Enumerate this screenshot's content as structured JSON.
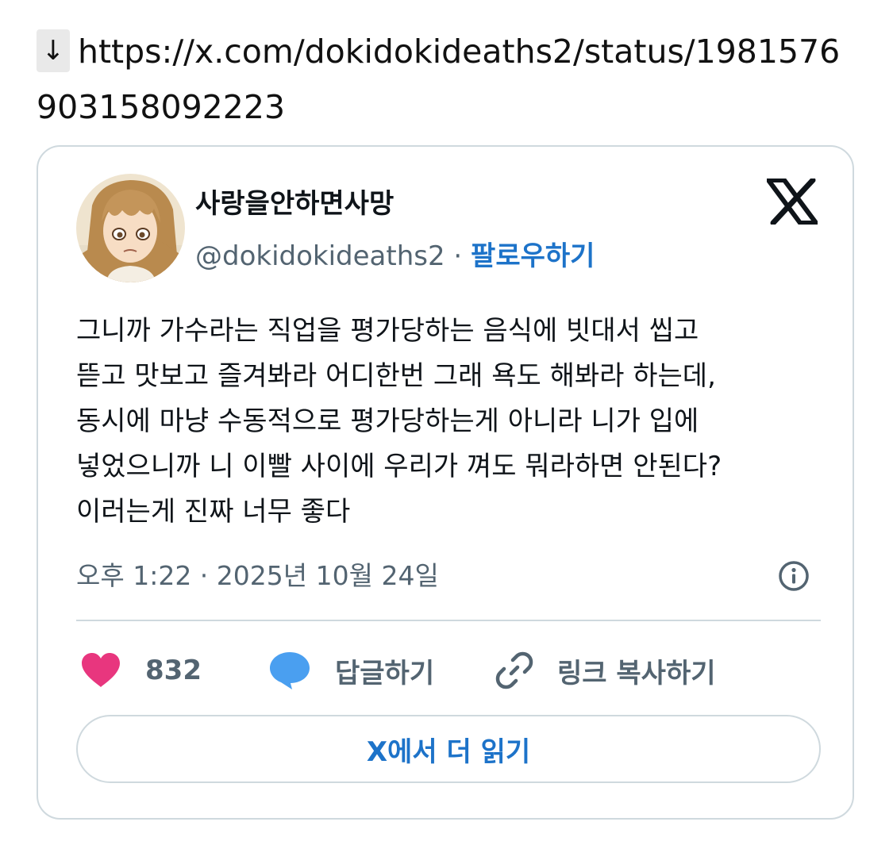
{
  "link": {
    "arrow": "↓",
    "url": "https://x.com/dokidokideaths2/status/1981576903158092223"
  },
  "tweet": {
    "display_name": "사랑을안하면사망",
    "handle": "@dokidokideaths2",
    "separator": " · ",
    "follow_label": "팔로우하기",
    "text": "그니까 가수라는 직업을 평가당하는 음식에 빗대서 씹고\n뜯고 맛보고 즐겨봐라 어디한번 그래 욕도 해봐라 하는데,\n동시에 마냥 수동적으로 평가당하는게 아니라 니가 입에\n넣었으니까 니 이빨 사이에 우리가 껴도 뭐라하면 안된다?\n이러는게 진짜 너무 좋다",
    "timestamp": "오후 1:22 · 2025년 10월 24일"
  },
  "actions": {
    "like_count": "832",
    "reply_label": "답글하기",
    "copy_link_label": "링크 복사하기"
  },
  "read_more_label": "X에서 더 읽기",
  "colors": {
    "like_heart": "#e8367e",
    "reply_bubble": "#4a9ff0",
    "link_blue": "#1d73c9",
    "muted_text": "#536471",
    "border": "#cfd9de"
  },
  "icons": [
    "x-logo-icon",
    "info-icon",
    "heart-icon",
    "speech-bubble-icon",
    "link-icon"
  ]
}
